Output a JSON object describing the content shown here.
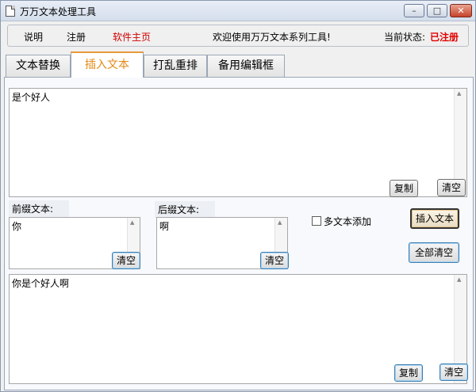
{
  "window": {
    "title": "万万文本处理工具",
    "controls": {
      "minimize": "–",
      "maximize": "□",
      "close": "✕"
    }
  },
  "menubar": {
    "help": "说明",
    "register": "注册",
    "homepage": "软件主页",
    "welcome": "欢迎使用万万文本系列工具!",
    "status_label": "当前状态:",
    "status_value": "已注册"
  },
  "tabs": [
    {
      "label": "文本替换",
      "active": false
    },
    {
      "label": "插入文本",
      "active": true
    },
    {
      "label": "打乱重排",
      "active": false
    },
    {
      "label": "备用编辑框",
      "active": false
    }
  ],
  "source": {
    "text": "是个好人",
    "copy_label": "复制",
    "clear_label": "清空"
  },
  "prefix": {
    "label": "前缀文本:",
    "text": "你",
    "clear_label": "清空"
  },
  "suffix": {
    "label": "后缀文本:",
    "text": "啊",
    "clear_label": "清空"
  },
  "options": {
    "multi_add_label": "多文本添加",
    "multi_add_checked": false
  },
  "actions": {
    "insert_label": "插入文本",
    "clear_all_label": "全部清空"
  },
  "result": {
    "text": "你是个好人啊",
    "copy_label": "复制",
    "clear_label": "清空"
  },
  "colors": {
    "accent_tab": "#e58a17",
    "alert_red": "#e00000"
  }
}
